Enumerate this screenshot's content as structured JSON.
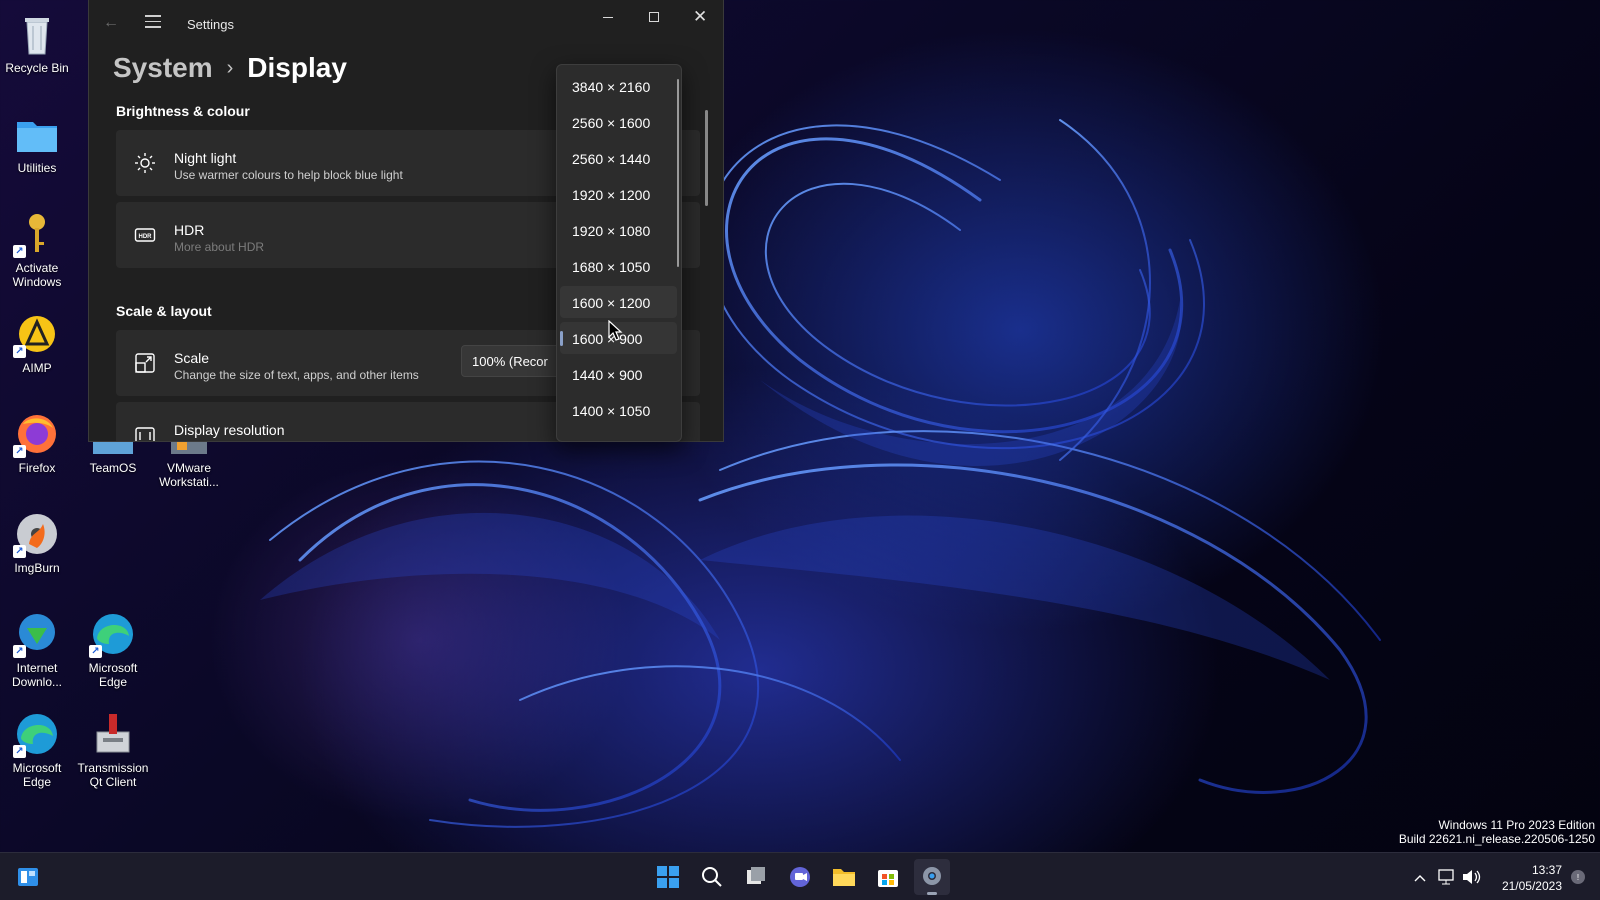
{
  "desktop": {
    "icons": [
      {
        "label": "Recycle Bin"
      },
      {
        "label": "Utilities"
      },
      {
        "label": "Activate Windows"
      },
      {
        "label": "AIMP"
      },
      {
        "label": "Firefox"
      },
      {
        "label": "TeamOS"
      },
      {
        "label": "VMware Workstati..."
      },
      {
        "label": "ImgBurn"
      },
      {
        "label": "Internet Downlo..."
      },
      {
        "label": "Microsoft Edge"
      },
      {
        "label": "Microsoft Edge"
      },
      {
        "label": "Transmission Qt Client"
      }
    ]
  },
  "settings": {
    "window_title": "Settings",
    "breadcrumb": {
      "parent": "System",
      "separator": "›",
      "current": "Display"
    },
    "brightness_section": "Brightness & colour",
    "night_light": {
      "title": "Night light",
      "subtitle": "Use warmer colours to help block blue light"
    },
    "hdr": {
      "title": "HDR",
      "subtitle": "More about HDR"
    },
    "scale_section": "Scale & layout",
    "scale": {
      "title": "Scale",
      "subtitle": "Change the size of text, apps, and other items",
      "value": "100% (Recor"
    },
    "display_resolution": {
      "title": "Display resolution"
    }
  },
  "resolution_dropdown": {
    "options": [
      "3840 × 2160",
      "2560 × 1600",
      "2560 × 1440",
      "1920 × 1200",
      "1920 × 1080",
      "1680 × 1050",
      "1600 × 1200",
      "1600 × 900",
      "1440 × 900",
      "1400 × 1050"
    ],
    "selected": "1600 × 900",
    "hovered": "1600 × 1200"
  },
  "watermark": {
    "line1": "Windows 11 Pro 2023 Edition",
    "line2": "Build 22621.ni_release.220506-1250"
  },
  "taskbar": {
    "time": "13:37",
    "date": "21/05/2023"
  },
  "colors": {
    "accent": "#0078d4",
    "window_bg": "#202020",
    "card_bg": "#2b2b2b"
  }
}
